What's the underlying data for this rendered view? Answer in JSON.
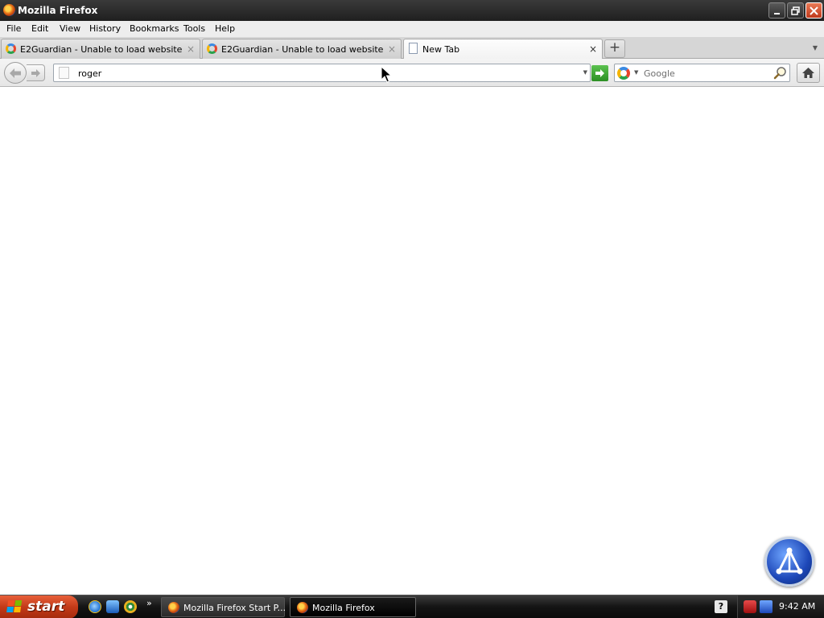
{
  "window": {
    "title": "Mozilla Firefox",
    "minimize_icon": "minimize-icon",
    "maximize_icon": "restore-icon",
    "close_icon": "close-icon"
  },
  "menubar": {
    "items": [
      {
        "label": "File"
      },
      {
        "label": "Edit"
      },
      {
        "label": "View"
      },
      {
        "label": "History"
      },
      {
        "label": "Bookmarks"
      },
      {
        "label": "Tools"
      },
      {
        "label": "Help"
      }
    ]
  },
  "tabs": [
    {
      "label": "E2Guardian - Unable to load website",
      "icon": "google-favicon",
      "active": false
    },
    {
      "label": "E2Guardian - Unable to load website",
      "icon": "google-favicon",
      "active": false
    },
    {
      "label": "New Tab",
      "icon": "blank-page-icon",
      "active": true
    }
  ],
  "tab_close_glyph": "×",
  "newtab_glyph": "+",
  "navbar": {
    "back_glyph": "🡐",
    "forward_glyph": "🡒",
    "url_value": "roger",
    "go_glyph": "➔",
    "search_placeholder": "Google"
  },
  "taskbar": {
    "start_label": "start",
    "quicklaunch_more": "»",
    "tasks": [
      {
        "label": "Mozilla Firefox Start P...",
        "active": false
      },
      {
        "label": "Mozilla Firefox",
        "active": true
      }
    ],
    "clock": "9:42 AM"
  },
  "colors": {
    "go_button": "#2c8f24",
    "start_button": "#c23a18",
    "taskbar": "#141414"
  }
}
